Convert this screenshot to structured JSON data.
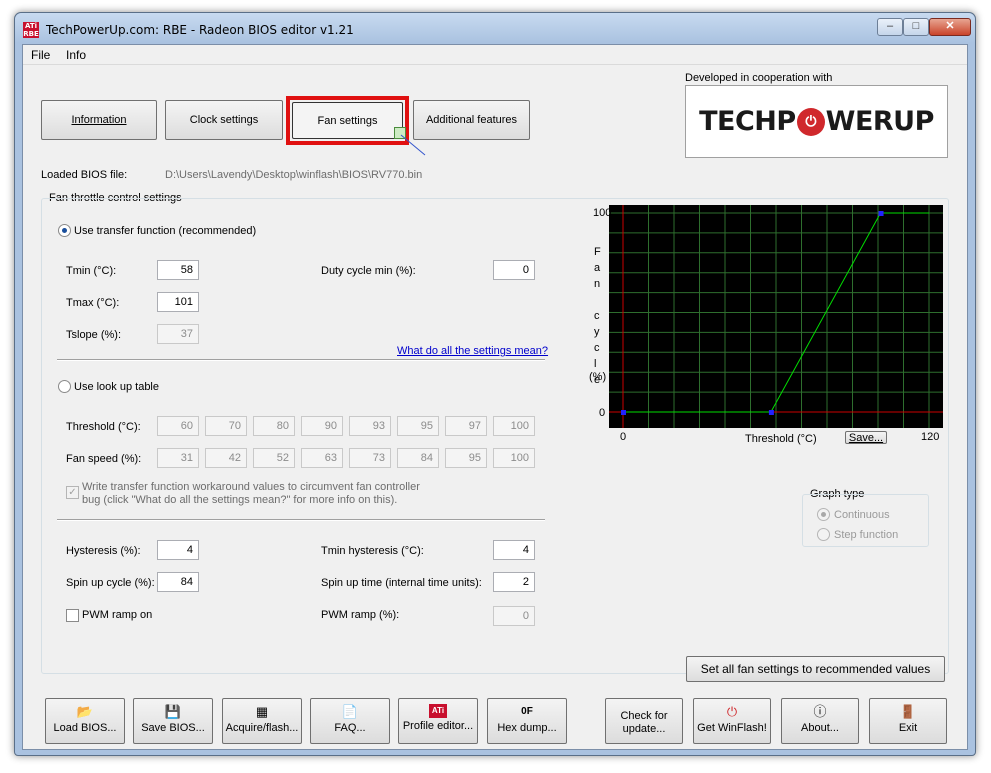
{
  "window": {
    "title": "TechPowerUp.com: RBE - Radeon BIOS editor v1.21",
    "icon_text": "ATi RBE",
    "controls": {
      "minimize": "–",
      "maximize": "□",
      "close": "✕"
    }
  },
  "menu": {
    "file": "File",
    "info": "Info"
  },
  "tabs": {
    "information": "Information",
    "clock": "Clock settings",
    "fan": "Fan settings",
    "additional": "Additional features"
  },
  "branding": {
    "cooperation": "Developed in cooperation with",
    "logo_left": "TECHP",
    "logo_o": "O",
    "logo_right": "WERUP"
  },
  "bios": {
    "label": "Loaded BIOS file:",
    "path": "D:\\Users\\Lavendy\\Desktop\\winflash\\BIOS\\RV770.bin"
  },
  "fan_group": {
    "title": "Fan throttle control settings",
    "transfer_label": "Use transfer function (recommended)",
    "tmin_label": "Tmin (°C):",
    "tmin_value": "58",
    "tmax_label": "Tmax (°C):",
    "tmax_value": "101",
    "tslope_label": "Tslope (%):",
    "tslope_value": "37",
    "duty_label": "Duty cycle min (%):",
    "duty_value": "0",
    "help_link": "What do all the settings mean?",
    "lookup_label": "Use look up table",
    "threshold_label": "Threshold (°C):",
    "threshold_values": [
      "60",
      "70",
      "80",
      "90",
      "93",
      "95",
      "97",
      "100"
    ],
    "fanspeed_label": "Fan speed (%):",
    "fanspeed_values": [
      "31",
      "42",
      "52",
      "63",
      "73",
      "84",
      "95",
      "100"
    ],
    "workaround_line1": "Write transfer function workaround values to circumvent fan controller",
    "workaround_line2": "bug (click \"What do all the settings mean?\" for more info on this).",
    "hysteresis_label": "Hysteresis (%):",
    "hysteresis_value": "4",
    "tmin_hyst_label": "Tmin hysteresis (°C):",
    "tmin_hyst_value": "4",
    "spin_cycle_label": "Spin up cycle (%):",
    "spin_cycle_value": "84",
    "spin_time_label": "Spin up time (internal time units):",
    "spin_time_value": "2",
    "pwm_on_label": "PWM ramp on",
    "pwm_ramp_label": "PWM ramp (%):",
    "pwm_ramp_value": "0"
  },
  "graph": {
    "y_max": "100",
    "y_min": "0",
    "x_min": "0",
    "x_max": "120",
    "x_label": "Threshold (°C)",
    "y_label_letters": [
      "F",
      "a",
      "n",
      "",
      "c",
      "y",
      "c",
      "l",
      "e"
    ],
    "y_unit": "(%)",
    "save_label": "Save...",
    "type_group": "Graph type",
    "continuous": "Continuous",
    "step": "Step function",
    "colors": {
      "background": "#000000",
      "grid": "#2e6e2e",
      "axis": "#cc0000",
      "curve": "#00dd00",
      "point": "#2222ff"
    }
  },
  "chart_data": {
    "type": "line",
    "x": [
      0,
      58,
      101,
      120
    ],
    "y": [
      0,
      0,
      100,
      100
    ],
    "xlim": [
      0,
      120
    ],
    "ylim": [
      0,
      100
    ],
    "xlabel": "Threshold (°C)",
    "ylabel": "Fan cycle (%)",
    "grid": true
  },
  "recommend_btn": "Set all fan settings to recommended values",
  "toolbar": [
    {
      "name": "load-bios-button",
      "icon_name": "open-folder-icon",
      "icon": "📂",
      "label": "Load BIOS..."
    },
    {
      "name": "save-bios-button",
      "icon_name": "floppy-disk-icon",
      "icon": "💾",
      "label": "Save BIOS..."
    },
    {
      "name": "acquire-flash-button",
      "icon_name": "chip-icon",
      "icon": "▦",
      "label": "Acquire/flash..."
    },
    {
      "name": "faq-button",
      "icon_name": "document-icon",
      "icon": "📄",
      "label": "FAQ..."
    },
    {
      "name": "profile-editor-button",
      "icon_name": "ati-logo-icon",
      "icon": "ATi",
      "label": "Profile editor..."
    },
    {
      "name": "hex-dump-button",
      "icon_name": "hex-icon",
      "icon": "0F",
      "label": "Hex dump..."
    }
  ],
  "toolbar_right": {
    "check_update": "Check for update...",
    "get_winflash": "Get WinFlash!",
    "about": "About...",
    "exit": "Exit"
  }
}
